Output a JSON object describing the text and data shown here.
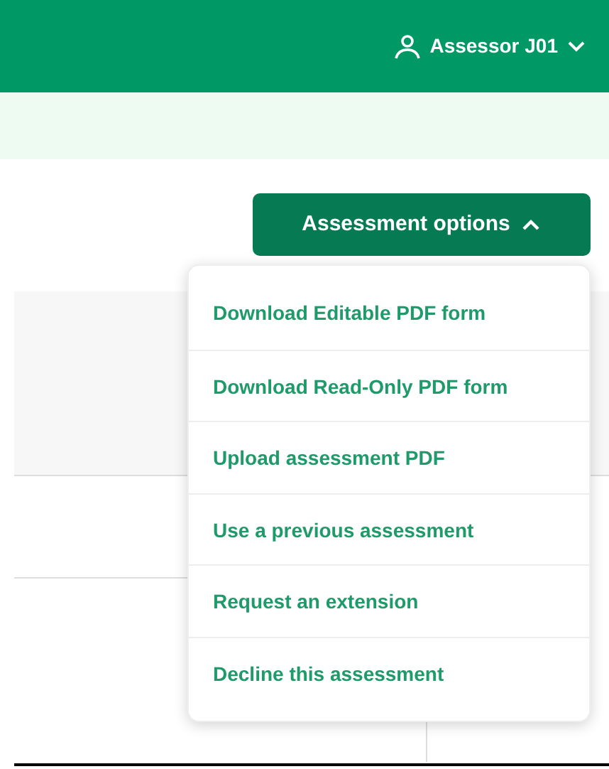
{
  "header": {
    "user": "Assessor J01"
  },
  "options_button": {
    "label": "Assessment options",
    "expanded": true
  },
  "menu": [
    {
      "label": "Download Editable PDF form"
    },
    {
      "label": "Download Read-Only PDF form"
    },
    {
      "label": "Upload assessment PDF"
    },
    {
      "label": "Use a previous assessment"
    },
    {
      "label": "Request an extension"
    },
    {
      "label": "Decline this assessment"
    }
  ]
}
